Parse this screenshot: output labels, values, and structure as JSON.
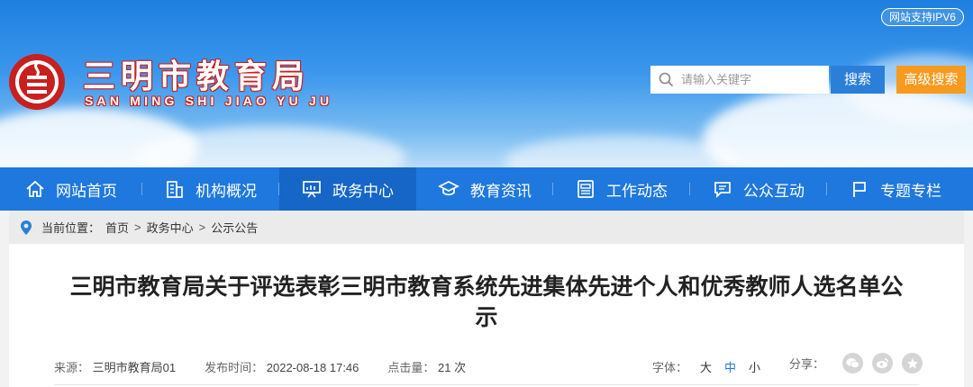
{
  "header": {
    "ipv6_badge": "网站支持IPV6",
    "site_name": "三明市教育局",
    "site_name_pinyin": "SAN MING SHI JIAO YU JU",
    "search": {
      "placeholder": "请输入关键字",
      "value": ""
    },
    "search_button": "搜索",
    "advanced_search_button": "高级搜索"
  },
  "nav": {
    "items": [
      {
        "label": "网站首页",
        "icon": "home-icon"
      },
      {
        "label": "机构概况",
        "icon": "building-icon"
      },
      {
        "label": "政务中心",
        "icon": "presentation-icon",
        "active": true
      },
      {
        "label": "教育资讯",
        "icon": "graduation-cap-icon"
      },
      {
        "label": "工作动态",
        "icon": "newspaper-icon"
      },
      {
        "label": "公众互动",
        "icon": "chat-icon"
      },
      {
        "label": "专题专栏",
        "icon": "flag-icon"
      }
    ]
  },
  "breadcrumb": {
    "prefix": "当前位置：",
    "items": [
      "首页",
      "政务中心",
      "公示公告"
    ],
    "separator": ">"
  },
  "article": {
    "title": "三明市教育局关于评选表彰三明市教育系统先进集体先进个人和优秀教师人选名单公示",
    "source_label": "来源：",
    "source": "三明市教育局01",
    "time_label": "发布时间：",
    "time": "2022-08-18 17:46",
    "views_label": "点击量：",
    "views": "21 次",
    "font_label": "字体：",
    "font_sizes": [
      "大",
      "中",
      "小"
    ],
    "share_label": "分享："
  },
  "colors": {
    "nav_bg": "#1f78dd",
    "nav_active": "#1566c6",
    "search_button": "#2b7fd9",
    "advanced_button": "#f79a1e",
    "logo_red": "#c8201f"
  }
}
